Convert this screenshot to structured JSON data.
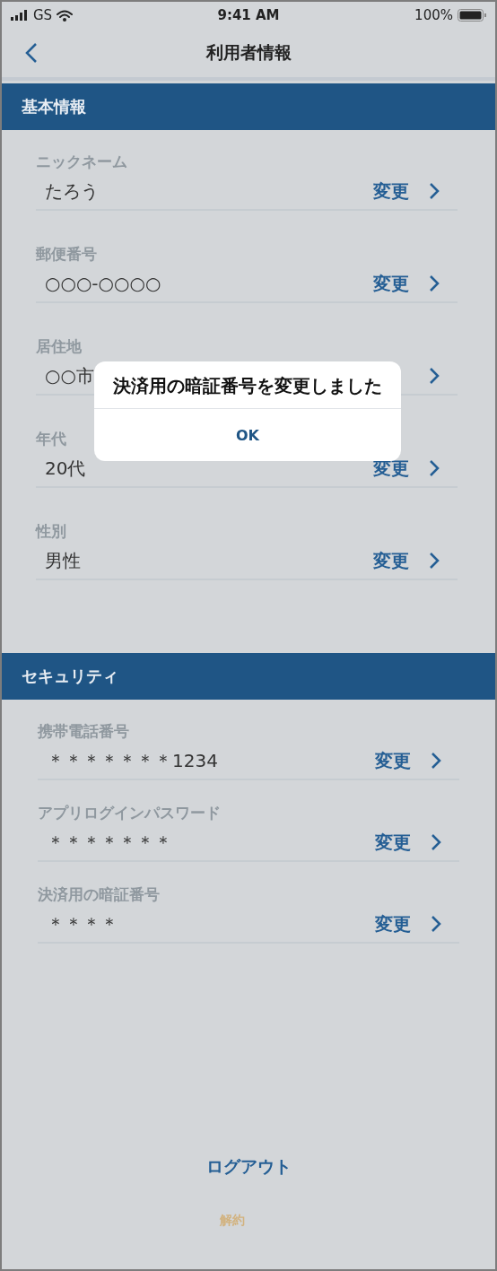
{
  "status_bar": {
    "carrier": "GS",
    "time": "9:41 AM",
    "battery": "100%"
  },
  "nav": {
    "title": "利用者情報"
  },
  "sections": [
    {
      "title": "基本情報",
      "kind": "basic",
      "rows": [
        {
          "label": "ニックネーム",
          "value": "たろう",
          "action": "変更"
        },
        {
          "label": "郵便番号",
          "value": "○○○-○○○○",
          "action": "変更"
        },
        {
          "label": "居住地",
          "value": "○○市"
        },
        {
          "label": "年代",
          "value": "20代",
          "action": "変更"
        },
        {
          "label": "性別",
          "value": "男性",
          "action": "変更"
        }
      ]
    },
    {
      "title": "セキュリティ",
      "kind": "security",
      "rows": [
        {
          "label": "携帯電話番号",
          "value": "＊＊＊＊＊＊＊1234",
          "action": "変更"
        },
        {
          "label": "アプリログインパスワード",
          "value": "＊＊＊＊＊＊＊",
          "action": "変更"
        },
        {
          "label": "決済用の暗証番号",
          "value": "＊＊＊＊",
          "action": "変更"
        }
      ]
    }
  ],
  "logout": "ログアウト",
  "cancel": "解約",
  "alert": {
    "message": "決済用の暗証番号を変更しました",
    "button": "OK"
  }
}
